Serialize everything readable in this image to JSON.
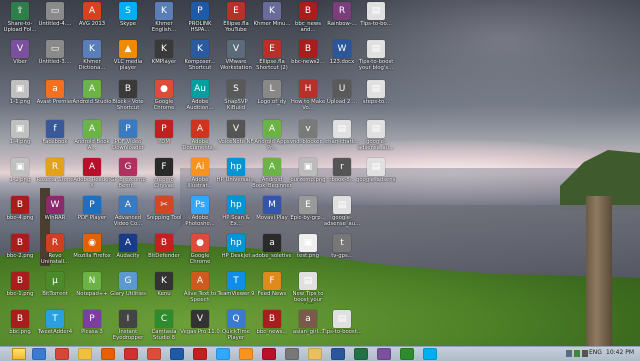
{
  "desktop": {
    "icons": [
      {
        "label": "Share-to-Upload Fol...",
        "color": "#2f7f4a",
        "glyph": "⇪"
      },
      {
        "label": "Untitled-4....",
        "color": "#8a8a8a",
        "glyph": "▭"
      },
      {
        "label": "AVG 2013",
        "color": "#d9411e",
        "glyph": "A"
      },
      {
        "label": "Skype",
        "color": "#00aff0",
        "glyph": "S"
      },
      {
        "label": "Khmer English...",
        "color": "#5a7fb8",
        "glyph": "K"
      },
      {
        "label": "PROLINK HSPA...",
        "color": "#1e5aa8",
        "glyph": "P"
      },
      {
        "label": "Ellipse.fla YouTube",
        "color": "#b8302a",
        "glyph": "E"
      },
      {
        "label": "Khmer Minu...",
        "color": "#6b6b9a",
        "glyph": "K"
      },
      {
        "label": "bbc_news and...",
        "color": "#aa1d1d",
        "glyph": "B"
      },
      {
        "label": "Rainbow-...",
        "color": "#7a3f7a",
        "glyph": "R"
      },
      {
        "label": "Tips-to-bo...",
        "color": "#e0e0e0",
        "glyph": "▤"
      },
      {
        "label": "Viber",
        "color": "#7b519d",
        "glyph": "V"
      },
      {
        "label": "Untitled-3....",
        "color": "#8a8a8a",
        "glyph": "▭"
      },
      {
        "label": "Khmer Dictiona...",
        "color": "#5a7fb8",
        "glyph": "K"
      },
      {
        "label": "VLC media player",
        "color": "#f08a00",
        "glyph": "▲"
      },
      {
        "label": "KMPlayer",
        "color": "#3a3a3a",
        "glyph": "K"
      },
      {
        "label": "Komposer... Shortcut",
        "color": "#2c5aa0",
        "glyph": "K"
      },
      {
        "label": "VMware Workstation",
        "color": "#5c6b7a",
        "glyph": "V"
      },
      {
        "label": "Ellipse.fla Shortcut (2)",
        "color": "#b8302a",
        "glyph": "E"
      },
      {
        "label": "bbc-news2...",
        "color": "#aa1d1d",
        "glyph": "B"
      },
      {
        "label": "123.docx",
        "color": "#2b579a",
        "glyph": "W"
      },
      {
        "label": "Tips-to-boost your blog's...",
        "color": "#e0e0e0",
        "glyph": "▤"
      },
      {
        "label": "1-1.png",
        "color": "#c0c0c0",
        "glyph": "▣"
      },
      {
        "label": "Avast Premier",
        "color": "#f37021",
        "glyph": "a"
      },
      {
        "label": "Android Studio",
        "color": "#6ab344",
        "glyph": "A"
      },
      {
        "label": "Block - Vote Shortcut",
        "color": "#3a3a3a",
        "glyph": "B"
      },
      {
        "label": "Google Chrome",
        "color": "#dd4b39",
        "glyph": "●"
      },
      {
        "label": "Adobe Audition...",
        "color": "#00a0a0",
        "glyph": "Au"
      },
      {
        "label": "SnapSVP KiBuild",
        "color": "#5a5a5a",
        "glyph": "S"
      },
      {
        "label": "Logo of_dy",
        "color": "#888",
        "glyph": "L"
      },
      {
        "label": "How to Make Vo...",
        "color": "#b8302a",
        "glyph": "H"
      },
      {
        "label": "Upload 2 ...",
        "color": "#5a5a5a",
        "glyph": "U"
      },
      {
        "label": "steps-to...",
        "color": "#e0e0e0",
        "glyph": "▤"
      },
      {
        "label": "1-4.png",
        "color": "#c0c0c0",
        "glyph": "▣"
      },
      {
        "label": "Facebook",
        "color": "#3b5998",
        "glyph": "f"
      },
      {
        "label": "Android Book A...",
        "color": "#6ab344",
        "glyph": "A"
      },
      {
        "label": "PDF Video Downloader",
        "color": "#3a7ac0",
        "glyph": "P"
      },
      {
        "label": "PDM",
        "color": "#c02020",
        "glyph": "P"
      },
      {
        "label": "Adobe Documents...",
        "color": "#d0341e",
        "glyph": "A"
      },
      {
        "label": "VoiceNote NF",
        "color": "#555",
        "glyph": "V"
      },
      {
        "label": "Android Apps Pr...",
        "color": "#6ab344",
        "glyph": "A"
      },
      {
        "label": "vnd_blocker...",
        "color": "#7a7a7a",
        "glyph": "v"
      },
      {
        "label": "chan-chatt...",
        "color": "#e0e0e0",
        "glyph": "▤"
      },
      {
        "label": "google-adsense_au...",
        "color": "#e0e0e0",
        "glyph": "▤"
      },
      {
        "label": "1-2.png",
        "color": "#c0c0c0",
        "glyph": "▣"
      },
      {
        "label": "Rosetta Stone",
        "color": "#e3a11c",
        "glyph": "R"
      },
      {
        "label": "Adobe Reader X",
        "color": "#b8102a",
        "glyph": "A"
      },
      {
        "label": "GP Brezcomp Bemt...",
        "color": "#b03060",
        "glyph": "G"
      },
      {
        "label": "Freemo Cityvac",
        "color": "#2a2a2a",
        "glyph": "F"
      },
      {
        "label": "Adobe Illustrat...",
        "color": "#f7931e",
        "glyph": "Ai"
      },
      {
        "label": "HP Universal...",
        "color": "#0096d6",
        "glyph": "hp"
      },
      {
        "label": "Android Book_Beginner",
        "color": "#6ab344",
        "glyph": "A"
      },
      {
        "label": "ourzemp.png",
        "color": "#bbb",
        "glyph": "▣"
      },
      {
        "label": "rbook-8...",
        "color": "#555",
        "glyph": "r"
      },
      {
        "label": "google_adsense_au...",
        "color": "#e0e0e0",
        "glyph": "▤"
      },
      {
        "label": "bbc-4.png",
        "color": "#aa1d1d",
        "glyph": "B"
      },
      {
        "label": "WinRAR",
        "color": "#8a2a6a",
        "glyph": "W"
      },
      {
        "label": "PDF Player",
        "color": "#1e6fc0",
        "glyph": "P"
      },
      {
        "label": "Advanced Video Co...",
        "color": "#3a7ac0",
        "glyph": "A"
      },
      {
        "label": "Snipping Tool",
        "color": "#d24726",
        "glyph": "✂"
      },
      {
        "label": "Adobe Photosho...",
        "color": "#31a8ff",
        "glyph": "Ps"
      },
      {
        "label": "HP Scan & Ex...",
        "color": "#0096d6",
        "glyph": "hp"
      },
      {
        "label": "Movavi Play",
        "color": "#3355aa",
        "glyph": "M"
      },
      {
        "label": "Epic-by-grp...",
        "color": "#999",
        "glyph": "E"
      },
      {
        "label": "google-adsense_au...",
        "color": "#e0e0e0",
        "glyph": "▤"
      },
      {
        "label": "bbc-2.png",
        "color": "#aa1d1d",
        "glyph": "B"
      },
      {
        "label": "Revo Uninstall...",
        "color": "#d04020",
        "glyph": "R"
      },
      {
        "label": "Mozilla Firefox",
        "color": "#e66000",
        "glyph": "◉"
      },
      {
        "label": "Audacity",
        "color": "#1a3a8a",
        "glyph": "A"
      },
      {
        "label": "BitDefender",
        "color": "#c81e1e",
        "glyph": "B"
      },
      {
        "label": "Google Chrome",
        "color": "#dd4b39",
        "glyph": "●"
      },
      {
        "label": "HP Deskjet",
        "color": "#0096d6",
        "glyph": "hp"
      },
      {
        "label": "adobe_soletiver...",
        "color": "#2a2a2a",
        "glyph": "a"
      },
      {
        "label": "test.png",
        "color": "#eee",
        "glyph": "▣"
      },
      {
        "label": "tv-gps...",
        "color": "#777",
        "glyph": "t"
      },
      {
        "label": "bbc-1.png",
        "color": "#aa1d1d",
        "glyph": "B"
      },
      {
        "label": "BitTorrent",
        "color": "#4a8a2a",
        "glyph": "μ"
      },
      {
        "label": "Notepad++",
        "color": "#6ab344",
        "glyph": "N"
      },
      {
        "label": "Glary Utilities",
        "color": "#5a9ad0",
        "glyph": "G"
      },
      {
        "label": "Kenu",
        "color": "#333",
        "glyph": "K"
      },
      {
        "label": "Alive Text to Speech",
        "color": "#d05a1e",
        "glyph": "A"
      },
      {
        "label": "TeamViewer 9",
        "color": "#0e8ee9",
        "glyph": "T"
      },
      {
        "label": "Feed News",
        "color": "#e08a1e",
        "glyph": "F"
      },
      {
        "label": "New Tips to boost your blog",
        "color": "#e0e0e0",
        "glyph": "▤"
      },
      {
        "label": "bbc.png",
        "color": "#aa1d1d",
        "glyph": "B"
      },
      {
        "label": "TweetAdder4",
        "color": "#2aa0e0",
        "glyph": "T"
      },
      {
        "label": "Picasa 3",
        "color": "#7a3fa0",
        "glyph": "P"
      },
      {
        "label": "Instant Eyedropper",
        "color": "#444",
        "glyph": "I"
      },
      {
        "label": "Camtasia Studio 8",
        "color": "#2e8b2e",
        "glyph": "C"
      },
      {
        "label": "Vegas Pro 11.0",
        "color": "#333",
        "glyph": "V"
      },
      {
        "label": "QuickTime Player",
        "color": "#3a7ad0",
        "glyph": "Q"
      },
      {
        "label": "bbc_news...",
        "color": "#aa1d1d",
        "glyph": "B"
      },
      {
        "label": "asian_girl...",
        "color": "#7a5a4a",
        "glyph": "a"
      },
      {
        "label": "Tips-to-boost...",
        "color": "#e0e0e0",
        "glyph": "▤"
      }
    ]
  },
  "taskbar": {
    "apps": [
      {
        "name": "ie",
        "color": "#3a7ad0"
      },
      {
        "name": "gmail",
        "color": "#d44638"
      },
      {
        "name": "explorer",
        "color": "#f0c040"
      },
      {
        "name": "firefox",
        "color": "#e66000"
      },
      {
        "name": "media",
        "color": "#d03030"
      },
      {
        "name": "chrome",
        "color": "#dd4b39"
      },
      {
        "name": "player",
        "color": "#1e5aa8"
      },
      {
        "name": "avg",
        "color": "#c02020"
      },
      {
        "name": "photoshop",
        "color": "#31a8ff"
      },
      {
        "name": "illustrator",
        "color": "#f7931e"
      },
      {
        "name": "acrobat",
        "color": "#b8102a"
      },
      {
        "name": "calc",
        "color": "#777"
      },
      {
        "name": "folder",
        "color": "#e8c060"
      },
      {
        "name": "word",
        "color": "#2b579a"
      },
      {
        "name": "excel",
        "color": "#217346"
      },
      {
        "name": "viber",
        "color": "#7b519d"
      },
      {
        "name": "camtasia",
        "color": "#2e8b2e"
      },
      {
        "name": "skype",
        "color": "#00aff0"
      }
    ],
    "language": "ENG",
    "clock": "10:42 PM"
  }
}
